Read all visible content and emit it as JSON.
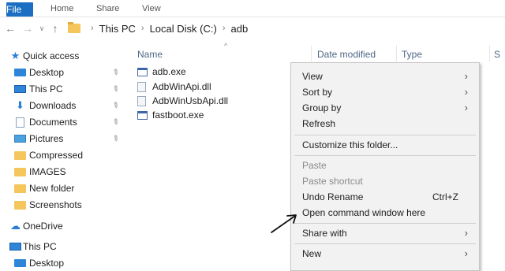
{
  "ribbon": {
    "tabs": [
      "File",
      "Home",
      "Share",
      "View"
    ]
  },
  "address": {
    "crumbs": [
      "This PC",
      "Local Disk (C:)",
      "adb"
    ]
  },
  "sidebar": {
    "items": [
      {
        "label": "Quick access",
        "icon": "star-icon",
        "pinned": false
      },
      {
        "label": "Desktop",
        "icon": "desktop-icon",
        "pinned": true
      },
      {
        "label": "This PC",
        "icon": "computer-icon",
        "pinned": true
      },
      {
        "label": "Downloads",
        "icon": "download-icon",
        "pinned": true
      },
      {
        "label": "Documents",
        "icon": "document-icon",
        "pinned": true
      },
      {
        "label": "Pictures",
        "icon": "pictures-icon",
        "pinned": true
      },
      {
        "label": "Compressed",
        "icon": "folder-icon",
        "pinned": false
      },
      {
        "label": "IMAGES",
        "icon": "folder-icon",
        "pinned": false
      },
      {
        "label": "New folder",
        "icon": "folder-icon",
        "pinned": false
      },
      {
        "label": "Screenshots",
        "icon": "folder-icon",
        "pinned": false
      },
      {
        "label": "OneDrive",
        "icon": "cloud-icon",
        "pinned": false
      },
      {
        "label": "This PC",
        "icon": "computer-icon",
        "pinned": false
      },
      {
        "label": "Desktop",
        "icon": "desktop-icon",
        "pinned": false
      }
    ]
  },
  "filelist": {
    "columns": {
      "name": "Name",
      "date": "Date modified",
      "type": "Type",
      "size": "S"
    },
    "files": [
      {
        "name": "adb.exe",
        "icon": "exe-icon"
      },
      {
        "name": "AdbWinApi.dll",
        "icon": "dll-icon"
      },
      {
        "name": "AdbWinUsbApi.dll",
        "icon": "dll-icon"
      },
      {
        "name": "fastboot.exe",
        "icon": "exe-icon"
      }
    ]
  },
  "context_menu": {
    "view": "View",
    "sort_by": "Sort by",
    "group_by": "Group by",
    "refresh": "Refresh",
    "customize": "Customize this folder...",
    "paste": "Paste",
    "paste_shortcut": "Paste shortcut",
    "undo_rename": "Undo Rename",
    "undo_shortcut": "Ctrl+Z",
    "open_cmd": "Open command window here",
    "share_with": "Share with",
    "new": "New"
  },
  "colors": {
    "file_tab": "#1b6ec2",
    "menu_bg": "#f2f2f2",
    "folder": "#f4c65c",
    "accent_blue": "#2a7fd6"
  }
}
